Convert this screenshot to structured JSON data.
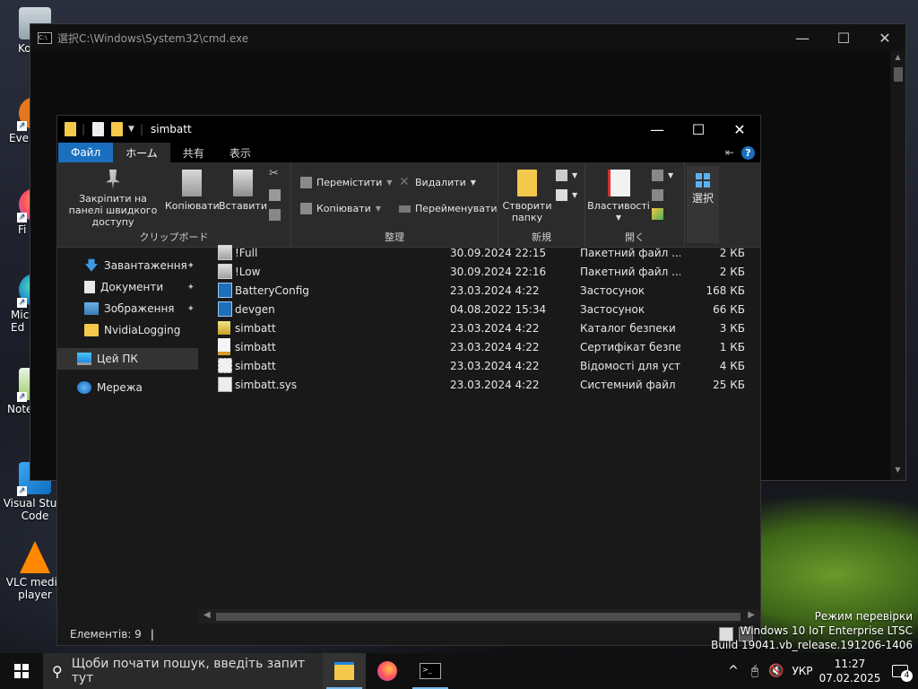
{
  "desktop": {
    "icons": [
      {
        "label": "Ko"
      },
      {
        "label": "Ever"
      },
      {
        "label": "Fi"
      },
      {
        "label": "Mic\nEd"
      },
      {
        "label": "Note"
      },
      {
        "label": "Visual Studi\nCode"
      },
      {
        "label": "VLC media\nplayer"
      }
    ]
  },
  "cmd_window": {
    "title": "選択C:\\Windows\\System32\\cmd.exe"
  },
  "explorer": {
    "title": "simbatt",
    "tabs": {
      "file": "Файл",
      "home": "ホーム",
      "share": "共有",
      "view": "表示"
    },
    "ribbon": {
      "clipboard": {
        "pin_label": "Закріпити на панелі швидкого доступу",
        "copy_label": "Копіювати",
        "paste_label": "Вставити",
        "group_label": "クリップボード"
      },
      "organize": {
        "move_label": "Перемістити",
        "copy_label": "Копіювати",
        "delete_label": "Видалити",
        "rename_label": "Перейменувати",
        "group_label": "整理"
      },
      "new": {
        "new_folder_label": "Створити папку",
        "group_label": "新規"
      },
      "open": {
        "properties_label": "Властивості",
        "group_label": "開く"
      },
      "select": {
        "select_label": "選択"
      }
    },
    "nav": {
      "items": [
        {
          "label": "Завантаження"
        },
        {
          "label": "Документи"
        },
        {
          "label": "Зображення"
        },
        {
          "label": "NvidiaLogging"
        },
        {
          "label": "Цей ПК"
        },
        {
          "label": "Мережа"
        }
      ]
    },
    "files": [
      {
        "name": "!Full",
        "date": "30.09.2024 22:15",
        "type": "Пакетний файл ...",
        "size": "2 КБ",
        "icon": "batch-file-icon"
      },
      {
        "name": "!Low",
        "date": "30.09.2024 22:16",
        "type": "Пакетний файл ...",
        "size": "2 КБ",
        "icon": "batch-file-icon"
      },
      {
        "name": "BatteryConfig",
        "date": "23.03.2024 4:22",
        "type": "Застосунок",
        "size": "168 КБ",
        "icon": "application-icon"
      },
      {
        "name": "devgen",
        "date": "04.08.2022 15:34",
        "type": "Застосунок",
        "size": "66 КБ",
        "icon": "application-icon"
      },
      {
        "name": "simbatt",
        "date": "23.03.2024 4:22",
        "type": "Каталог безпеки",
        "size": "3 КБ",
        "icon": "security-catalog-icon"
      },
      {
        "name": "simbatt",
        "date": "23.03.2024 4:22",
        "type": "Сертифікат безпе...",
        "size": "1 КБ",
        "icon": "certificate-icon"
      },
      {
        "name": "simbatt",
        "date": "23.03.2024 4:22",
        "type": "Відомості для уст...",
        "size": "4 КБ",
        "icon": "setup-info-icon"
      },
      {
        "name": "simbatt.sys",
        "date": "23.03.2024 4:22",
        "type": "Системний файл",
        "size": "25 КБ",
        "icon": "system-file-icon"
      }
    ],
    "status": {
      "count": "Елементів: 9",
      "sep": "|"
    }
  },
  "watermark": {
    "line1": "Режим перевірки",
    "line2": "Windows 10 IoT Enterprise LTSC",
    "line3": "Build 19041.vb_release.191206-1406"
  },
  "taskbar": {
    "search_placeholder": "Щоби почати пошук, введіть запит тут",
    "language": "УКР",
    "time": "11:27",
    "date": "07.02.2025",
    "notification_count": "4"
  },
  "colors": {
    "accent": "#1a6fbf",
    "folder": "#f4c84b",
    "taskbar_indicator": "#76b9ed"
  }
}
